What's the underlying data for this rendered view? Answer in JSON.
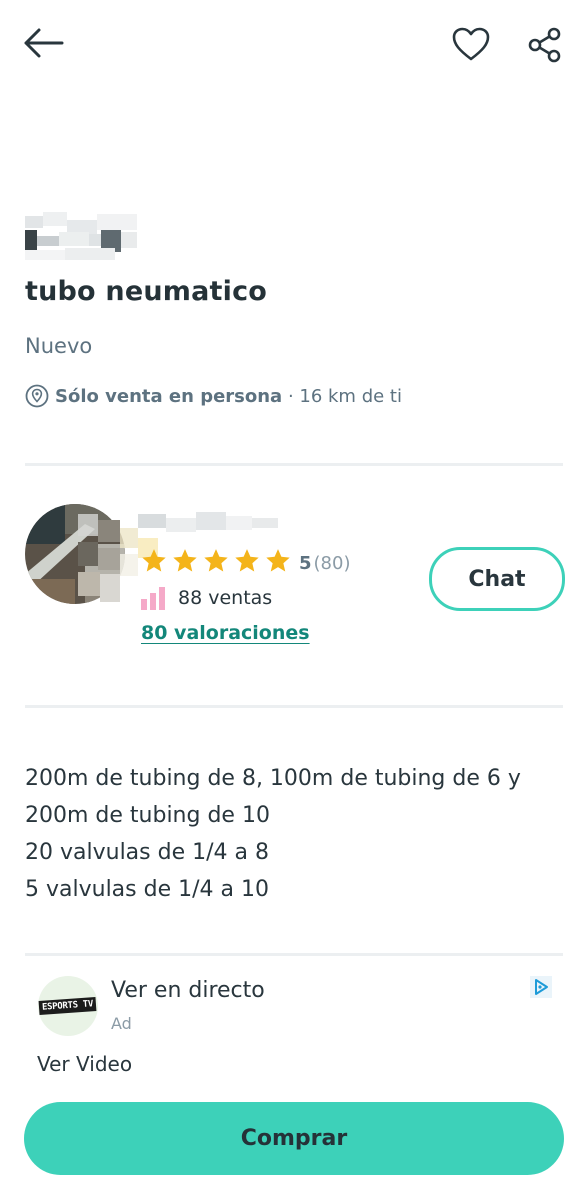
{
  "header": {
    "back_icon": "arrow-left-icon",
    "favorite_icon": "heart-outline-icon",
    "share_icon": "share-icon"
  },
  "product": {
    "title": "tubo neumatico",
    "condition": "Nuevo",
    "delivery_bold": "Sólo venta en persona",
    "delivery_distance": " · 16 km de ti"
  },
  "seller": {
    "rating_value": "5",
    "rating_count": "(80)",
    "sales": "88 ventas",
    "reviews_link": "80 valoraciones",
    "chat_label": "Chat"
  },
  "description": {
    "lines": [
      "200m de tubing de 8, 100m de tubing de 6 y",
      "200m de tubing de 10",
      "20 valvulas de 1/4 a 8",
      "5 valvulas de 1/4 a 10"
    ]
  },
  "ad": {
    "logo_text": "ESPORTS TV",
    "title": "Ver en directo",
    "label": "Ad",
    "cta": "Ver Video"
  },
  "footer": {
    "buy_label": "Comprar"
  },
  "colors": {
    "accent": "#3dd1b9",
    "link": "#13877a",
    "star": "#f4b41a",
    "text": "#29363d",
    "muted": "#5d7280"
  }
}
